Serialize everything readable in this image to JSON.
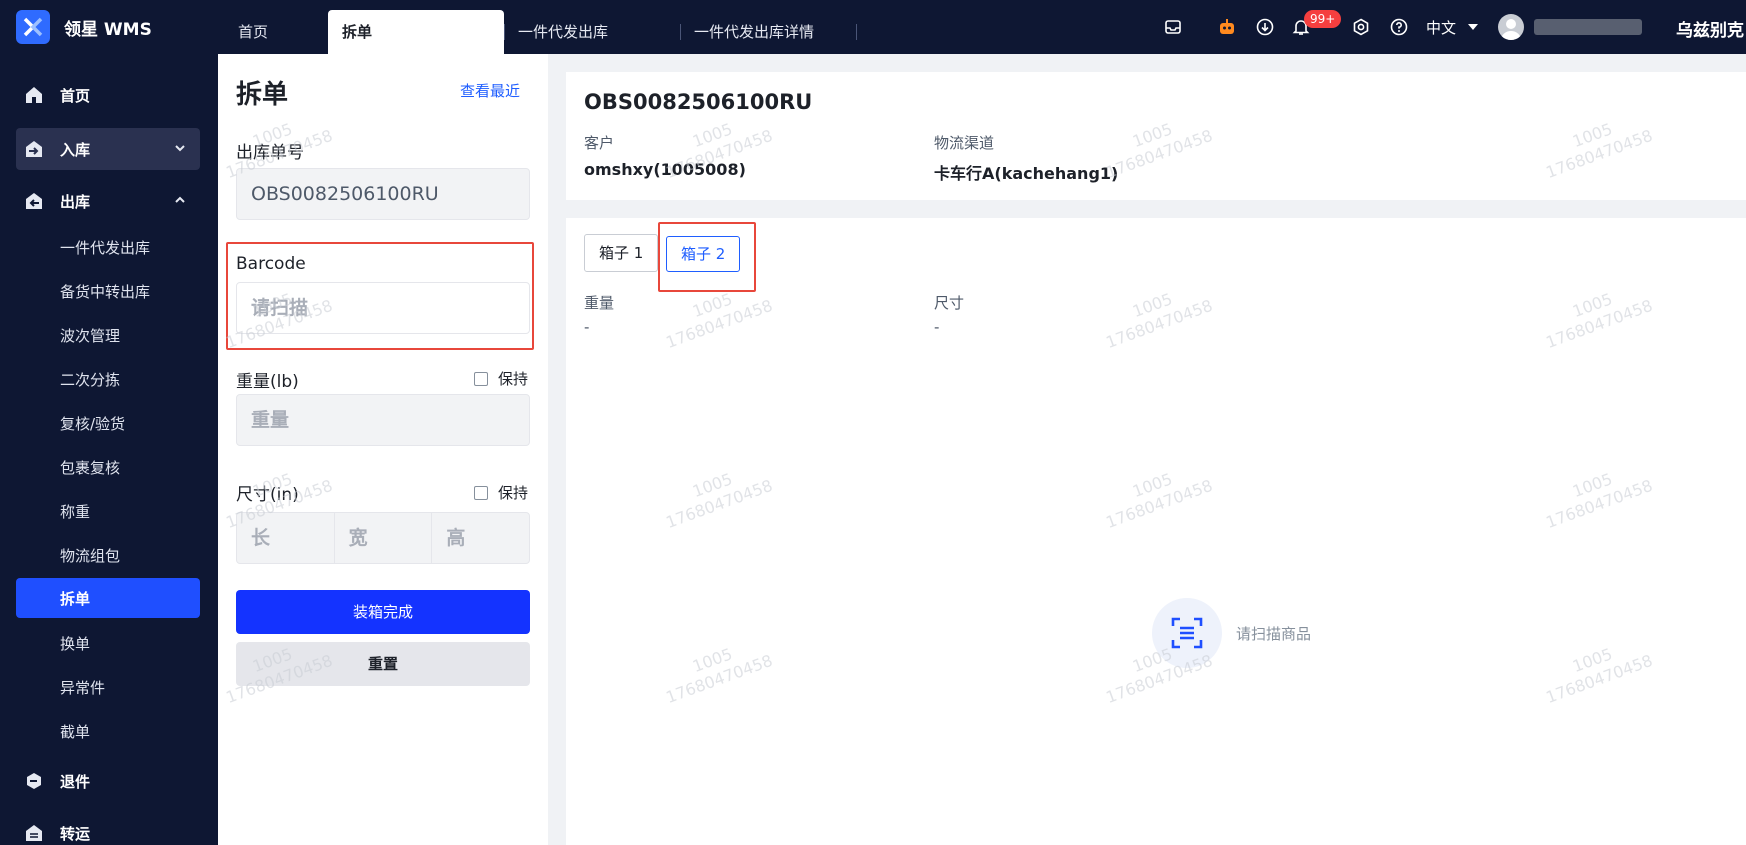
{
  "app": {
    "title": "领星 WMS",
    "org_name": "乌兹别克"
  },
  "top_tabs": [
    {
      "label": "首页"
    },
    {
      "label": "拆单"
    },
    {
      "label": "一件代发出库"
    },
    {
      "label": "一件代发出库详情"
    }
  ],
  "header": {
    "notification_badge": "99+",
    "language": "中文"
  },
  "sidebar": {
    "items": [
      {
        "label": "首页"
      },
      {
        "label": "入库"
      },
      {
        "label": "出库"
      },
      {
        "label": "一件代发出库"
      },
      {
        "label": "备货中转出库"
      },
      {
        "label": "波次管理"
      },
      {
        "label": "二次分拣"
      },
      {
        "label": "复核/验货"
      },
      {
        "label": "包裹复核"
      },
      {
        "label": "称重"
      },
      {
        "label": "物流组包"
      },
      {
        "label": "拆单"
      },
      {
        "label": "换单"
      },
      {
        "label": "异常件"
      },
      {
        "label": "截单"
      },
      {
        "label": "退件"
      },
      {
        "label": "转运"
      }
    ]
  },
  "form": {
    "title": "拆单",
    "recent_link": "查看最近",
    "order_label": "出库单号",
    "order_value": "OBS0082506100RU",
    "barcode_label": "Barcode",
    "barcode_placeholder": "请扫描",
    "weight_label": "重量(lb)",
    "weight_placeholder": "重量",
    "keep_label": "保持",
    "size_label": "尺寸(in)",
    "length_placeholder": "长",
    "width_placeholder": "宽",
    "height_placeholder": "高",
    "submit_label": "装箱完成",
    "reset_label": "重置"
  },
  "order": {
    "number": "OBS0082506100RU",
    "customer_label": "客户",
    "customer_value": "omshxy(1005008)",
    "channel_label": "物流渠道",
    "channel_value": "卡车行A(kachehang1)"
  },
  "boxes": {
    "tabs": [
      {
        "label": "箱子 1"
      },
      {
        "label": "箱子 2"
      }
    ],
    "weight_label": "重量",
    "weight_value": "-",
    "size_label": "尺寸",
    "size_value": "-",
    "empty_text": "请扫描商品"
  },
  "watermark": {
    "line1": "1005",
    "line2": "17680470458"
  },
  "colors": {
    "brand": "#1f5eff",
    "primary_button": "#1433ff",
    "nav_bg": "#0e1733",
    "highlight_frame": "#e8473b"
  }
}
